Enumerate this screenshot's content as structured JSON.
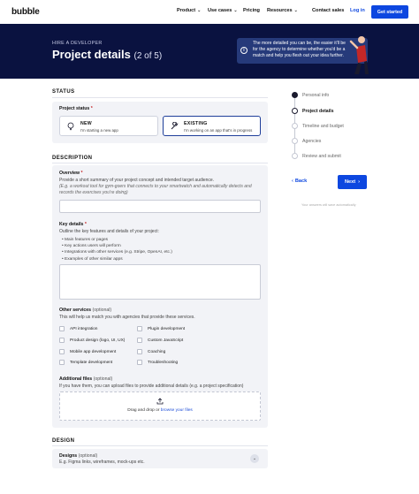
{
  "nav": {
    "logo": "bubble",
    "items": [
      {
        "label": "Product",
        "chevron": true
      },
      {
        "label": "Use cases",
        "chevron": true
      },
      {
        "label": "Pricing",
        "chevron": false
      },
      {
        "label": "Resources",
        "chevron": true
      }
    ],
    "contact_sales": "Contact sales",
    "login": "Log in",
    "get_started": "Get started",
    "accent": "#0d47e0"
  },
  "hero": {
    "eyebrow": "HIRE A DEVELOPER",
    "title": "Project details",
    "step": "(2 of 5)",
    "note": "The more detailed you can be, the easier it'll be for the agency to determine whether you'd be a match and help you flesh out your idea further.",
    "background": "#0a1240"
  },
  "status": {
    "heading": "STATUS",
    "field_label": "Project status",
    "required": "*",
    "options": [
      {
        "title": "NEW",
        "subtitle": "I'm starting a new app",
        "icon": "lightbulb-icon",
        "selected": false
      },
      {
        "title": "EXISTING",
        "subtitle": "I'm working on an app that's in progress",
        "icon": "wrench-icon",
        "selected": true
      }
    ]
  },
  "description": {
    "heading": "DESCRIPTION",
    "overview_label": "Overview",
    "overview_help": "Provide a short summary of your project concept and intended target audience.",
    "overview_example": "(E.g. a workout tool for gym-goers that connects to your smartwatch and automatically detects and records the exercises you're doing)",
    "overview_value": "",
    "key_details_label": "Key details",
    "key_details_help": "Outline the key features and details of your project:",
    "key_details_bullets": [
      "Main features or pages",
      "Key actions users will perform",
      "Integrations with other services (e.g. Stripe, OpenAI, etc.)",
      "Examples of other similar apps"
    ],
    "key_details_value": "",
    "other_services_label": "Other services",
    "optional": "(optional)",
    "other_services_help": "This will help us match you with agencies that provide these services.",
    "services": [
      "API integration",
      "Plugin development",
      "Product design (logo, UI, UX)",
      "Custom JavaScript",
      "Mobile app development",
      "Coaching",
      "Template development",
      "Troubleshooting"
    ],
    "files_label": "Additional files",
    "files_help": "If you have them, you can upload files to provide additional details (e.g. a project specification)",
    "dropzone_text": "Drag and drop or",
    "dropzone_link": "browse your files"
  },
  "design": {
    "heading": "DESIGN",
    "designs_label": "Designs",
    "designs_help": "E.g. Figma links, wireframes, mock-ups etc."
  },
  "stepper": {
    "steps": [
      {
        "label": "Personal info",
        "state": "done"
      },
      {
        "label": "Project details",
        "state": "active"
      },
      {
        "label": "Timeline and budget",
        "state": "todo"
      },
      {
        "label": "Agencies",
        "state": "todo"
      },
      {
        "label": "Review and submit",
        "state": "todo"
      }
    ],
    "back": "Back",
    "next": "Next",
    "autosave": "Your answers will save automatically"
  }
}
